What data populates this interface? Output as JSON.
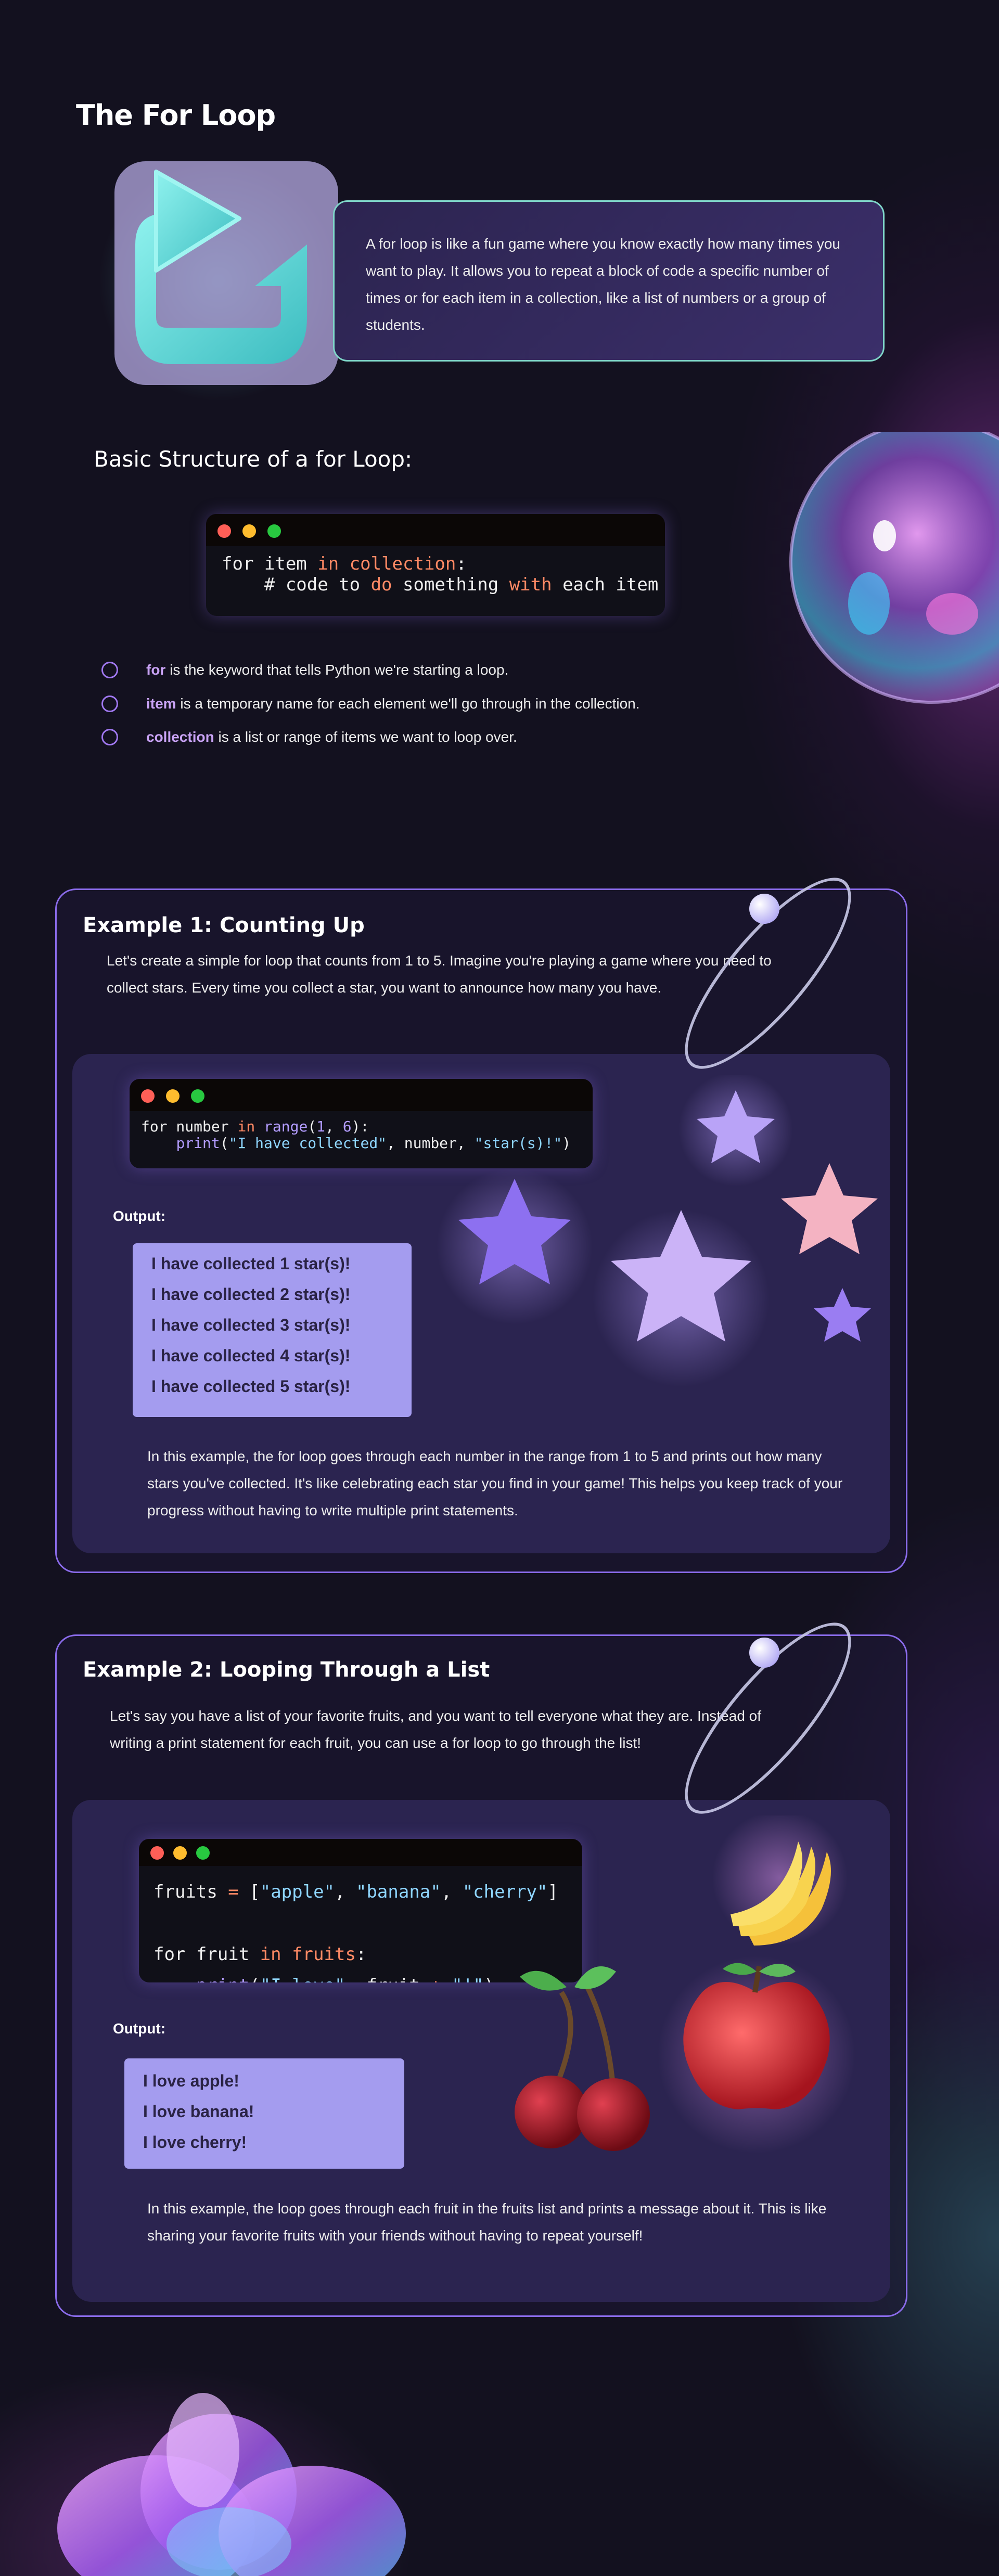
{
  "title": "The For Loop",
  "intro": {
    "text": "A for loop is like a fun game where you know exactly how many times you want to play. It allows you to repeat a block of code a specific number of times or for each item in a collection, like a list of numbers or a group of students."
  },
  "structure": {
    "heading": "Basic Structure of a for Loop:",
    "code": {
      "line1_a": "for item ",
      "line1_in": "in",
      "line1_b": " ",
      "line1_coll": "collection",
      "line1_c": ":",
      "line2_a": "    # code to ",
      "line2_do": "do",
      "line2_b": " something ",
      "line2_with": "with",
      "line2_c": " each item"
    },
    "bullets": [
      {
        "term": "for",
        "text": " is the keyword that tells Python we're starting a loop."
      },
      {
        "term": "item",
        "text": " is a temporary name for each element we'll go through in the collection."
      },
      {
        "term": "collection",
        "text": " is a list or range of items we want to loop over."
      }
    ]
  },
  "example1": {
    "heading": "Example 1: Counting Up",
    "description": "Let's create a simple for loop that counts from 1 to 5. Imagine you're playing a game where you need to collect stars. Every time you collect a star, you want to announce how many you have.",
    "code": {
      "l1_a": "for number ",
      "l1_in": "in",
      "l1_sp": " ",
      "l1_range": "range",
      "l1_p1": "(",
      "l1_n1": "1",
      "l1_comma": ", ",
      "l1_n2": "6",
      "l1_p2": "):",
      "l2_ind": "    ",
      "l2_print": "print",
      "l2_p1": "(",
      "l2_s1": "\"I have collected\"",
      "l2_mid": ", number, ",
      "l2_s2": "\"star(s)!\"",
      "l2_p2": ")"
    },
    "output_label": "Output:",
    "output": [
      "I have collected 1 star(s)!",
      "I have collected 2 star(s)!",
      "I have collected 3 star(s)!",
      "I have collected 4 star(s)!",
      "I have collected 5 star(s)!"
    ],
    "explanation": "In this example, the for loop goes through each number in the range from 1 to 5 and prints out how many stars you've collected. It's like celebrating each star you find in your game! This helps you keep track of your progress without having to write multiple print statements."
  },
  "example2": {
    "heading": "Example 2: Looping Through a List",
    "description": "Let's say you have a list of your favorite fruits, and you want to tell everyone what they are. Instead of writing a print statement for each fruit, you can use a for loop to go through the list!",
    "code": {
      "l1_a": "fruits ",
      "l1_eq": "=",
      "l1_b": " [",
      "l1_s1": "\"apple\"",
      "l1_c1": ", ",
      "l1_s2": "\"banana\"",
      "l1_c2": ", ",
      "l1_s3": "\"cherry\"",
      "l1_end": "]",
      "l3_a": "for fruit ",
      "l3_in": "in",
      "l3_sp": " ",
      "l3_fruits": "fruits",
      "l3_colon": ":",
      "l4_ind": "    ",
      "l4_print": "print",
      "l4_p1": "(",
      "l4_s1": "\"I love\"",
      "l4_mid": ", fruit ",
      "l4_plus": "+",
      "l4_sp": " ",
      "l4_s2": "\"!\"",
      "l4_p2": ")"
    },
    "output_label": "Output:",
    "output": [
      "I love apple!",
      "I love banana!",
      "I love cherry!"
    ],
    "explanation": "In this example, the loop goes through each fruit in the fruits list and prints a message about it. This is like sharing your favorite fruits with your friends without having to repeat yourself!"
  },
  "colors": {
    "accent": "#8a6bea",
    "teal": "#5fd3cf",
    "code_keyword": "#ff8a65",
    "code_string": "#8fd6ff",
    "output_bg": "#a49cef"
  },
  "icons": [
    "loop-icon",
    "glass-sphere",
    "orbit-ring",
    "star",
    "banana",
    "cherry",
    "apple",
    "glass-flower"
  ]
}
